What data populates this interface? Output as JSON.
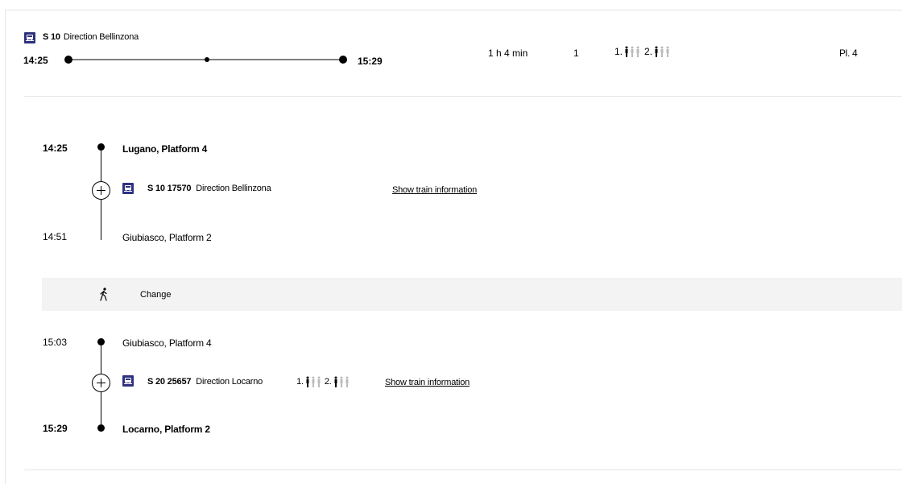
{
  "summary": {
    "line_code": "S 10",
    "direction": "Direction Bellinzona",
    "departure": "14:25",
    "arrival": "15:29",
    "duration": "1 h 4 min",
    "changes": "1",
    "class1_label": "1.",
    "class2_label": "2.",
    "platform": "Pl. 4"
  },
  "legs": [
    {
      "dep_time": "14:25",
      "dep_stop": "Lugano, Platform 4",
      "code": "S 10 17570",
      "direction": "Direction Bellinzona",
      "info_link": "Show train information",
      "arr_time": "14:51",
      "arr_stop": "Giubiasco, Platform 2"
    },
    {
      "dep_time": "15:03",
      "dep_stop": "Giubiasco, Platform 4",
      "code": "S 20 25657",
      "direction": "Direction Locarno",
      "class1_label": "1.",
      "class2_label": "2.",
      "info_link": "Show train information",
      "arr_time": "15:29",
      "arr_stop": "Locarno, Platform 2"
    }
  ],
  "change": {
    "label": "Change"
  },
  "colors": {
    "train_icon": "#2d327d",
    "separator": "#e6e6e6",
    "change_bg": "#f3f3f3"
  },
  "icons": [
    "train-icon",
    "occupancy-icon",
    "walk-icon",
    "plus-icon"
  ]
}
